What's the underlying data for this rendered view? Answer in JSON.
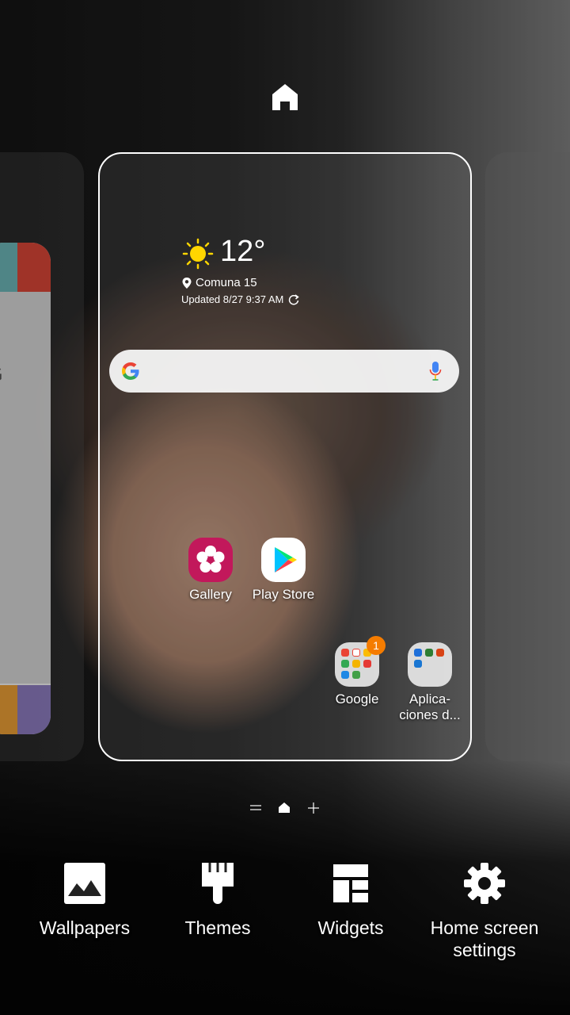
{
  "weather": {
    "temperature": "12°",
    "location": "Comuna 15",
    "updated": "Updated 8/27 9:37 AM"
  },
  "apps": [
    {
      "label": "Gallery"
    },
    {
      "label": "Play Store"
    },
    {
      "label": "Google",
      "badge": "1"
    },
    {
      "label": "Aplica-\nciones d..."
    }
  ],
  "bottom_options": [
    {
      "label": "Wallpapers",
      "icon": "wallpapers-icon"
    },
    {
      "label": "Themes",
      "icon": "themes-brush-icon"
    },
    {
      "label": "Widgets",
      "icon": "widgets-icon"
    },
    {
      "label": "Home screen settings",
      "icon": "gear-icon"
    }
  ],
  "colors": {
    "gallery": "#c2185b",
    "badge": "#f57c00",
    "sun": "#ffd600"
  }
}
